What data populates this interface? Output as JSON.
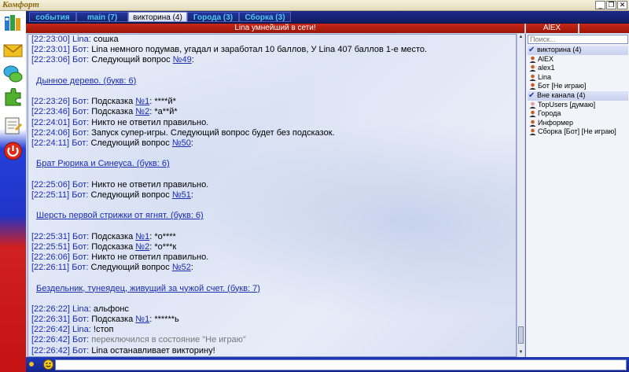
{
  "window": {
    "title": "Комфорт",
    "btn_min": "_",
    "btn_restore": "❐",
    "btn_close": "✕"
  },
  "tabs": [
    {
      "label": "события"
    },
    {
      "label": "main (7)"
    },
    {
      "label": "викторина (4)"
    },
    {
      "label": "Города (3)"
    },
    {
      "label": "Сборка (3)"
    }
  ],
  "channel": {
    "topic": "Lina умнейший в сети!",
    "nick_header": "AlEX"
  },
  "chat": {
    "lines": [
      {
        "ts": "[22:23:00]",
        "nick": "Lina:",
        "text": " сошка"
      },
      {
        "ts": "[22:23:01]",
        "nick": "Бот:",
        "text": " Lina  немного подумав, угадал и заработал  10  баллов, У Lina 407 баллов 1-е место."
      },
      {
        "ts": "[22:23:06]",
        "nick": "Бот:",
        "text": "   Следующий вопрос ",
        "link": "№49",
        "after": ":"
      },
      {
        "question": "Дынное дерево. (букв: 6)"
      },
      {
        "ts": "[22:23:26]",
        "nick": "Бот:",
        "text": " Подсказка ",
        "link": "№1",
        "after": ": ****й*"
      },
      {
        "ts": "[22:23:46]",
        "nick": "Бот:",
        "text": " Подсказка ",
        "link": "№2",
        "after": ": *а**й*"
      },
      {
        "ts": "[22:24:01]",
        "nick": "Бот:",
        "text": " Никто не ответил правильно."
      },
      {
        "ts": "[22:24:06]",
        "nick": "Бот:",
        "text": " Запуск супер-игры. Следующий вопрос будет без подсказок."
      },
      {
        "ts": "[22:24:11]",
        "nick": "Бот:",
        "text": "   Следующий вопрос ",
        "link": "№50",
        "after": ":"
      },
      {
        "question": "Брат Рюрика и Синеуса. (букв: 6)"
      },
      {
        "ts": "[22:25:06]",
        "nick": "Бот:",
        "text": " Никто не ответил правильно."
      },
      {
        "ts": "[22:25:11]",
        "nick": "Бот:",
        "text": "   Следующий вопрос ",
        "link": "№51",
        "after": ":"
      },
      {
        "question": "Шерсть первой стрижки от ягнят. (букв: 6)"
      },
      {
        "ts": "[22:25:31]",
        "nick": "Бот:",
        "text": " Подсказка ",
        "link": "№1",
        "after": ": *о****"
      },
      {
        "ts": "[22:25:51]",
        "nick": "Бот:",
        "text": " Подсказка ",
        "link": "№2",
        "after": ": *о***к"
      },
      {
        "ts": "[22:26:06]",
        "nick": "Бот:",
        "text": " Никто не ответил правильно."
      },
      {
        "ts": "[22:26:11]",
        "nick": "Бот:",
        "text": "   Следующий вопрос ",
        "link": "№52",
        "after": ":"
      },
      {
        "question": "Бездельник, тунеядец, живущий за чужой счет. (букв: 7)"
      },
      {
        "ts": "[22:26:22]",
        "nick": "Lina:",
        "text": " альфонс"
      },
      {
        "ts": "[22:26:31]",
        "nick": "Бот:",
        "text": " Подсказка ",
        "link": "№1",
        "after": ": ******ь"
      },
      {
        "ts": "[22:26:42]",
        "nick": "Lina:",
        "text": " !стоп"
      },
      {
        "ts": "[22:26:42]",
        "nick": "Бот:",
        "grey": " переключился в состояние \"Не играю\""
      },
      {
        "ts": "[22:26:42]",
        "nick": "Бот:",
        "text": " Lina останавливает викторину!"
      }
    ]
  },
  "search": {
    "placeholder": "Поиск..."
  },
  "nicklist": [
    {
      "type": "group",
      "label": "викторина (4)"
    },
    {
      "type": "user",
      "label": "AlEX",
      "color": "#c06020"
    },
    {
      "type": "user",
      "label": "alex1",
      "color": "#c06020"
    },
    {
      "type": "user",
      "label": "Lina",
      "color": "#c06020"
    },
    {
      "type": "user",
      "label": "Бот [Не играю]",
      "color": "#c06020"
    },
    {
      "type": "group",
      "label": "Вне канала (4)"
    },
    {
      "type": "user",
      "label": "TopUsers [думаю]",
      "color": "#e0a0a0"
    },
    {
      "type": "user",
      "label": "Города",
      "color": "#c06020"
    },
    {
      "type": "user",
      "label": "Информер",
      "color": "#c06020"
    },
    {
      "type": "user",
      "label": "Сборка [Бот] [Не играю]",
      "color": "#c06020"
    }
  ],
  "colors": {
    "accent": "#1a2cb0",
    "header_red": "#c82818",
    "tab_blue": "#1c2a8a"
  }
}
